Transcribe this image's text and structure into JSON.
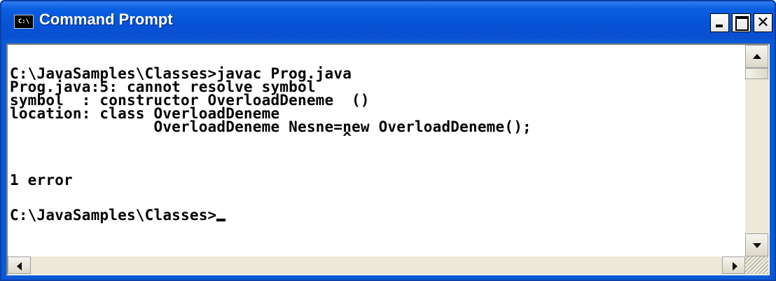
{
  "window": {
    "title": "Command Prompt",
    "icon_name": "console-icon",
    "icon_text": "C:\\",
    "controls": [
      "minimize-icon",
      "maximize-icon",
      "close-icon"
    ]
  },
  "console": {
    "lines": [
      "C:\\JavaSamples\\Classes>javac Prog.java",
      "Prog.java:5: cannot resolve symbol",
      "symbol  : constructor OverloadDeneme  ()",
      "location: class OverloadDeneme",
      "                OverloadDeneme Nesne=new OverloadDeneme();",
      "                                     ^",
      "",
      "1 error",
      "",
      "C:\\JavaSamples\\Classes>"
    ]
  },
  "colors": {
    "titlebar": "#0653d6",
    "console_background": "#ffffff",
    "console_text": "#000000"
  }
}
